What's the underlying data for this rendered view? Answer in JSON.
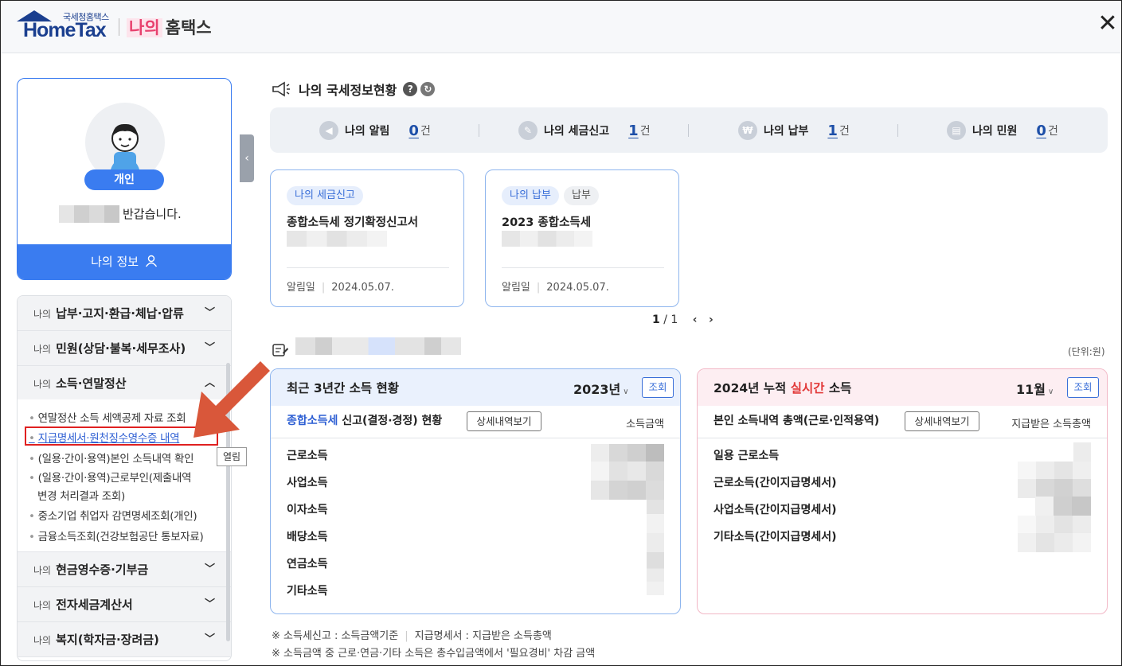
{
  "header": {
    "logo_small": "국세청홈택스",
    "logo_main": "HomeTax",
    "title_highlight": "나의",
    "title_rest": "홈택스",
    "close_label": "✕"
  },
  "profile": {
    "badge": "개인",
    "greeting": "반갑습니다.",
    "my_info": "나의 정보"
  },
  "menu": {
    "sections": [
      {
        "prefix": "나의",
        "label": "납부·고지·환급·체납·압류"
      },
      {
        "prefix": "나의",
        "label": "민원(상담·불복·세무조사)"
      },
      {
        "prefix": "나의",
        "label": "소득·연말정산"
      },
      {
        "prefix": "나의",
        "label": "현금영수증·기부금"
      },
      {
        "prefix": "나의",
        "label": "전자세금계산서"
      },
      {
        "prefix": "나의",
        "label": "복지(학자금·장려금)"
      }
    ],
    "sub_items": [
      "연말정산 소득 세액공제 자료 조회",
      "지급명세서·원천징수영수증 내역",
      "(일용·간이·용역)본인 소득내역 확인",
      "(일용·간이·용역)근로부인(제출내역",
      "변경 처리결과 조회)",
      "중소기업 취업자 감면명세조회(개인)",
      "금융소득조회(건강보험공단 통보자료)"
    ],
    "open_tip": "열림"
  },
  "status": {
    "title": "나의 국세정보현황",
    "items": [
      {
        "label": "나의 알림",
        "count": "0",
        "unit": "건"
      },
      {
        "label": "나의 세금신고",
        "count": "1",
        "unit": "건"
      },
      {
        "label": "나의 납부",
        "count": "1",
        "unit": "건"
      },
      {
        "label": "나의 민원",
        "count": "0",
        "unit": "건"
      }
    ]
  },
  "cards": [
    {
      "tags": [
        "나의 세금신고"
      ],
      "title": "종합소득세 정기확정신고서",
      "date_label": "알림일",
      "date": "2024.05.07."
    },
    {
      "tags": [
        "나의 납부",
        "납부"
      ],
      "title": "2023 종합소득세",
      "date_label": "알림일",
      "date": "2024.05.07."
    }
  ],
  "pager": {
    "current": "1",
    "sep": "/",
    "total": "1"
  },
  "unit_label": "(단위:원)",
  "left_panel": {
    "title": "최근 3년간 소득 현황",
    "year": "2023년",
    "view": "조회",
    "sub_blue": "종합소득세",
    "sub_rest": " 신고(결정·경정) 현황",
    "detail": "상세내역보기",
    "col": "소득금액",
    "rows": [
      "근로소득",
      "사업소득",
      "이자소득",
      "배당소득",
      "연금소득",
      "기타소득"
    ]
  },
  "right_panel": {
    "title_pre": "2024년 누적 ",
    "title_red": "실시간",
    "title_post": " 소득",
    "month": "11월",
    "view": "조회",
    "sub": "본인 소득내역 총액(근로·인적용역)",
    "detail": "상세내역보기",
    "col": "지급받은 소득총액",
    "rows": [
      "일용 근로소득",
      "근로소득(간이지급명세서)",
      "사업소득(간이지급명세서)",
      "기타소득(간이지급명세서)"
    ]
  },
  "notes": {
    "line1_a": "※ 소득세신고 : 소득금액기준",
    "line1_b": "지급명세서 : 지급받은 소득총액",
    "line2": "※ 소득금액 중 근로·연금·기타 소득은 총수입금액에서 '필요경비' 차감 금액"
  }
}
